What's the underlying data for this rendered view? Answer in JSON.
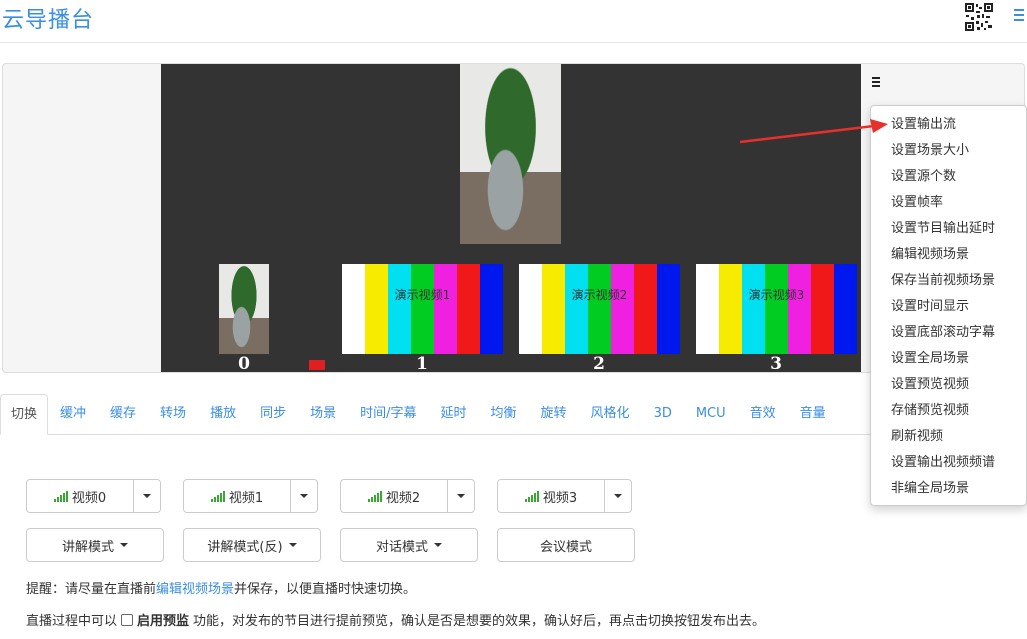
{
  "header": {
    "title": "云导播台",
    "qr_icon": "qr-code-icon",
    "menu_icon": "hamburger-icon"
  },
  "stage": {
    "thumb_numbers": [
      "0",
      "1",
      "2",
      "3"
    ],
    "demo_labels": [
      "演示视频1",
      "演示视频2",
      "演示视频3"
    ],
    "color_bars": [
      "#ffffff",
      "#f7ec00",
      "#00e0f0",
      "#00cc22",
      "#f020e0",
      "#f01818",
      "#0018f0"
    ]
  },
  "menu": {
    "items": [
      "设置输出流",
      "设置场景大小",
      "设置源个数",
      "设置帧率",
      "设置节目输出延时",
      "编辑视频场景",
      "保存当前视频场景",
      "设置时间显示",
      "设置底部滚动字幕",
      "设置全局场景",
      "设置预览视频",
      "存储预览视频",
      "刷新视频",
      "设置输出视频频谱",
      "非编全局场景"
    ]
  },
  "tabs": [
    "切换",
    "缓冲",
    "缓存",
    "转场",
    "播放",
    "同步",
    "场景",
    "时间/字幕",
    "延时",
    "均衡",
    "旋转",
    "风格化",
    "3D",
    "MCU",
    "音效",
    "音量"
  ],
  "sources": [
    "视频0",
    "视频1",
    "视频2",
    "视频3"
  ],
  "modes": [
    "讲解模式",
    "讲解模式(反)",
    "对话模式",
    "会议模式"
  ],
  "tip": {
    "prefix": "提醒：请尽量在直播前",
    "link": "编辑视频场景",
    "suffix": "并保存，以便直播时快速切换。"
  },
  "note": {
    "prefix": "直播过程中可以",
    "bold": "启用预监",
    "suffix": "功能，对发布的节目进行提前预览，确认是否是想要的效果，确认好后，再点击切换按钮发布出去。"
  },
  "colors": {
    "accent": "#3a8ee6",
    "canvas": "#333333",
    "arrow": "#e8302a",
    "signal": "#38a832"
  }
}
